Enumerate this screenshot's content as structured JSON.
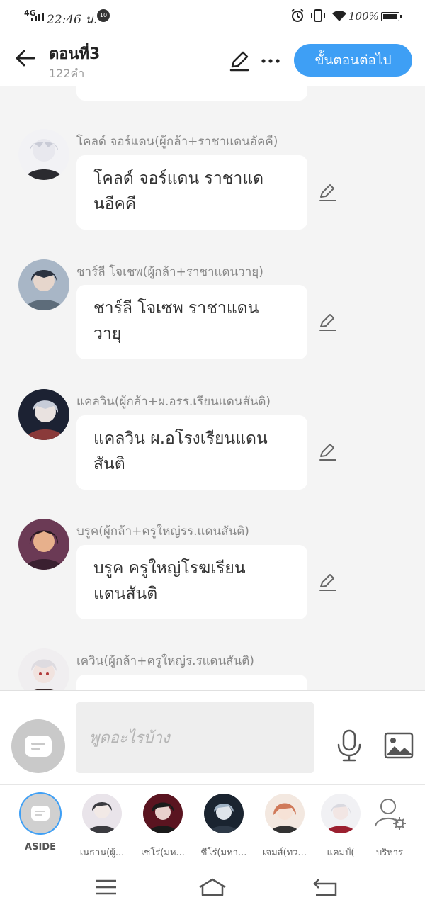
{
  "status_bar": {
    "network": "4G",
    "time": "22:46 น.",
    "notification_count": "10",
    "battery": "100%"
  },
  "header": {
    "title": "ตอนที่3",
    "word_count": "122คำ",
    "next_button": "ขั้นตอนต่อไป"
  },
  "messages": [
    {
      "name": "โคลด์ จอร์แดน(ผู้กล้า+ราชาแดนอัคคี)",
      "text_lines": [
        "โคลด์ จอร์แดน ราชาแด",
        "นอีคคี"
      ],
      "avatar_colors": [
        "#2b2b30",
        "#e8e8ee",
        "#8c8fa8"
      ]
    },
    {
      "name": "ชาร์ลี โจเชพ(ผู้กล้า+ราชาแดนวายุ)",
      "text_lines": [
        "ชาร์ลี โจเซพ ราชาแดน",
        "วายุ"
      ],
      "avatar_colors": [
        "#2c3340",
        "#a8b6c6",
        "#5d6c7a"
      ]
    },
    {
      "name": "แคลวิน(ผู้กล้า+ผ.อรร.เรียนแดนสันติ)",
      "text_lines": [
        "แคลวิน ผ.อโรงเรียนแดน",
        "สันติ"
      ],
      "avatar_colors": [
        "#1c2233",
        "#c7ccd8",
        "#8a3a3a"
      ]
    },
    {
      "name": "บรูค(ผู้กล้า+ครูใหญ่รร.แดนสันติ)",
      "text_lines": [
        "บรูค ครูใหญ่โรฆเรียน",
        "แดนสันติ"
      ],
      "avatar_colors": [
        "#2a1a22",
        "#e7b08c",
        "#6b3a55"
      ]
    },
    {
      "name": "เควิน(ผู้กล้า+ครูใหญ่ร.รแดนสันติ)",
      "text_lines": [
        "",
        ""
      ],
      "avatar_colors": [
        "#f0eef0",
        "#b23a3a",
        "#3a2a2a"
      ]
    }
  ],
  "input": {
    "placeholder": "พูดอะไรบ้าง"
  },
  "characters": [
    {
      "label": "ASIDE"
    },
    {
      "label": "เนธาน(ผู้...",
      "colors": [
        "#3b3b40",
        "#e9e4ea"
      ]
    },
    {
      "label": "เซโร่(มห...",
      "colors": [
        "#5a1420",
        "#1a1a1a"
      ]
    },
    {
      "label": "ซีโร่(มหา...",
      "colors": [
        "#1a2430",
        "#9fb2c4"
      ]
    },
    {
      "label": "เจมส์(ทว...",
      "colors": [
        "#f3e8e0",
        "#d07a5a"
      ]
    },
    {
      "label": "แคมป์(",
      "colors": [
        "#f1f1f4",
        "#9b2030"
      ]
    },
    {
      "label": "บริหาร"
    }
  ],
  "icons": [
    "back-arrow-icon",
    "pencil-icon",
    "more-dots-icon",
    "microphone-icon",
    "image-icon",
    "manage-characters-icon",
    "menu-icon",
    "home-icon",
    "back-icon"
  ],
  "accent_color": "#3e9ff5"
}
